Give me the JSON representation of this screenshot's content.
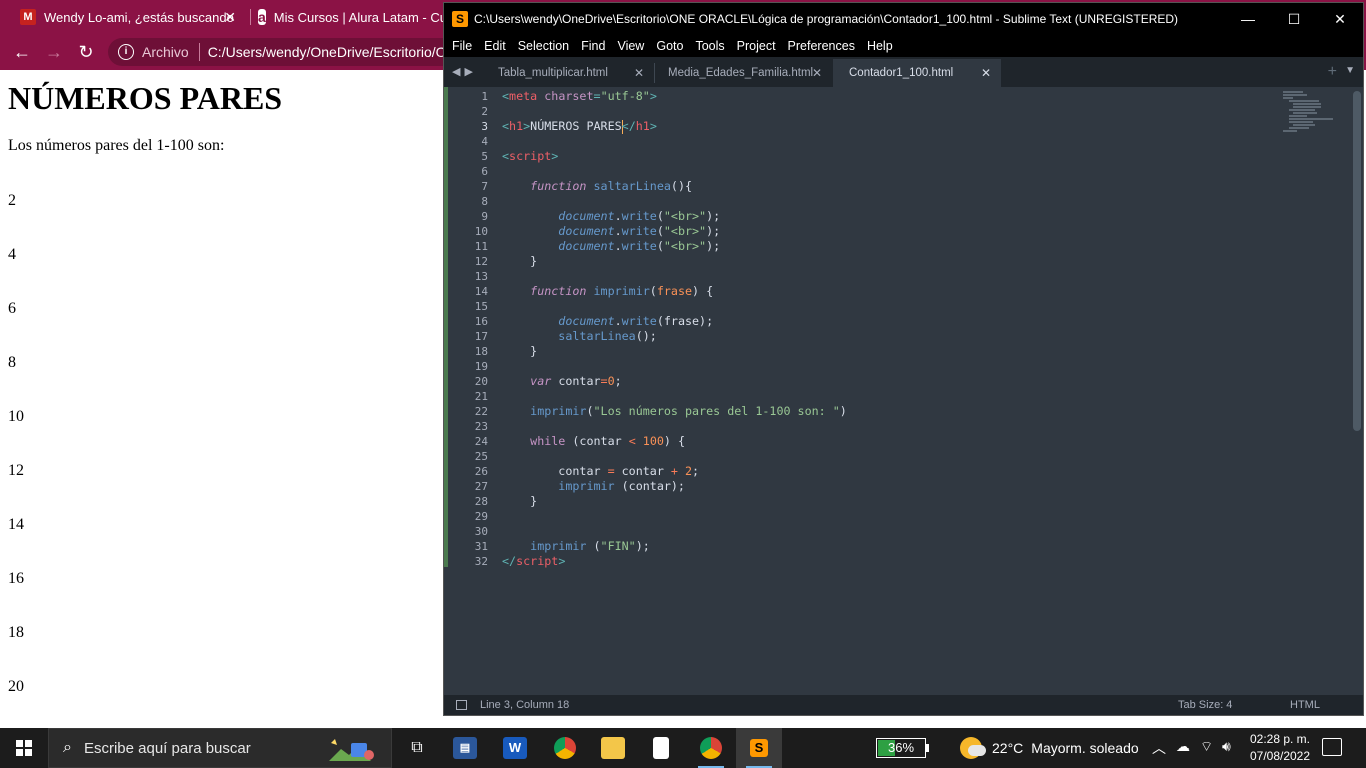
{
  "browser": {
    "tabs": [
      {
        "title": "Wendy Lo-ami, ¿estás buscando",
        "favicon": "gmail-icon"
      },
      {
        "title": "Mis Cursos | Alura Latam - Cur",
        "favicon": "alura-icon"
      }
    ],
    "omnibox": {
      "scheme_label": "Archivo",
      "url": "C:/Users/wendy/OneDrive/Escritorio/O"
    },
    "page": {
      "heading": "NÚMEROS PARES",
      "intro": "Los números pares del 1-100 son:",
      "numbers": [
        "2",
        "4",
        "6",
        "8",
        "10",
        "12",
        "14",
        "16",
        "18",
        "20"
      ]
    }
  },
  "sublime": {
    "title": "C:\\Users\\wendy\\OneDrive\\Escritorio\\ONE ORACLE\\Lógica de programación\\Contador1_100.html - Sublime Text (UNREGISTERED)",
    "menu": [
      "File",
      "Edit",
      "Selection",
      "Find",
      "View",
      "Goto",
      "Tools",
      "Project",
      "Preferences",
      "Help"
    ],
    "tabs": [
      {
        "label": "Tabla_multiplicar.html",
        "active": false
      },
      {
        "label": "Media_Edades_Familia.html",
        "active": false
      },
      {
        "label": "Contador1_100.html",
        "active": true
      }
    ],
    "current_line": 3,
    "status": {
      "position": "Line 3, Column 18",
      "tab_size": "Tab Size: 4",
      "syntax": "HTML"
    }
  },
  "taskbar": {
    "search_placeholder": "Escribe aquí para buscar",
    "battery": "36%",
    "battery_level": 0.36,
    "weather_temp": "22°C",
    "weather_desc": "Mayorm. soleado",
    "time": "02:28 p. m.",
    "date": "07/08/2022"
  },
  "colors": {
    "browser_accent": "#8b1245",
    "editor_bg": "#303841",
    "taskbar_bg": "#1c1c1c"
  }
}
